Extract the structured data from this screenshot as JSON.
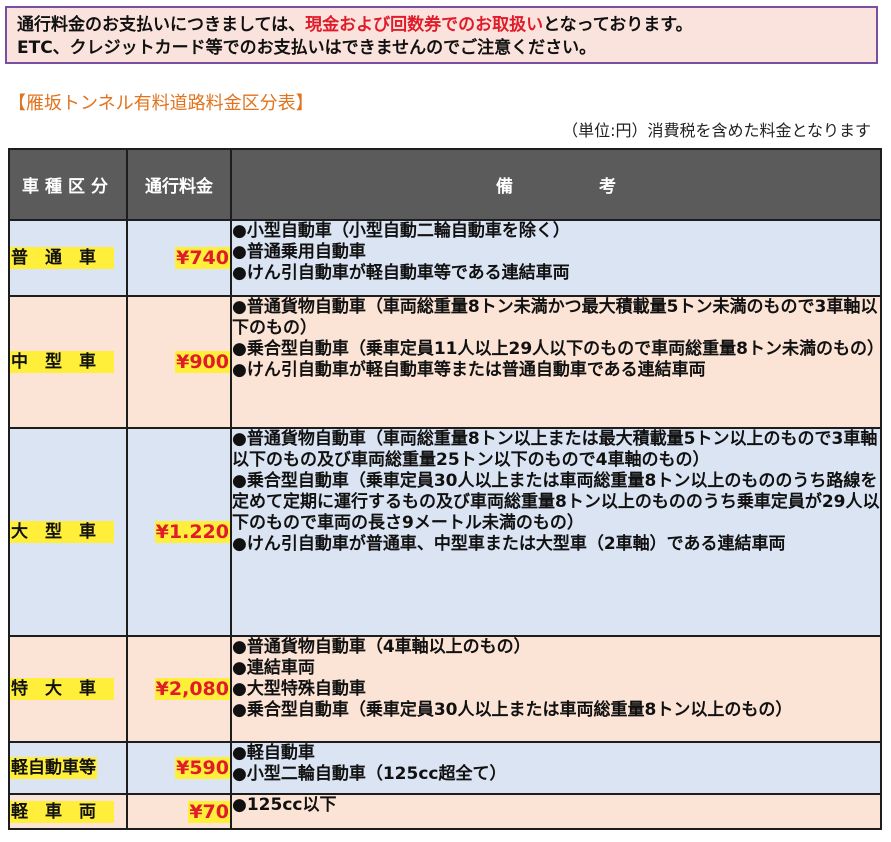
{
  "notice": {
    "line1_before": "通行料金のお支払いにつきましては、",
    "line1_highlight": "現金および回数券でのお取扱い",
    "line1_after": "となっております。",
    "line2": "ETC、クレジットカード等でのお支払いはできませんのでご注意ください。"
  },
  "section_title": "【雁坂トンネル有料道路料金区分表】",
  "unit_note": "（単位:円）消費税を含めた料金となります",
  "table": {
    "headers": {
      "type": "車種区分",
      "fee": "通行料金",
      "remarks": "備 考"
    },
    "rows": [
      {
        "type": "普通車",
        "fee": "¥740",
        "remarks": [
          "●小型自動車（小型自動二輪自動車を除く）",
          "●普通乗用自動車",
          "●けん引自動車が軽自動車等である連結車両"
        ]
      },
      {
        "type": "中型車",
        "fee": "¥900",
        "remarks": [
          "●普通貨物自動車（車両総重量8トン未満かつ最大積載量5トン未満のもので3車軸以下のもの）",
          "●乗合型自動車（乗車定員11人以上29人以下のもので車両総重量8トン未満のもの）",
          "●けん引自動車が軽自動車等または普通自動車である連結車両"
        ]
      },
      {
        "type": "大型車",
        "fee": "¥1.220",
        "remarks": [
          "●普通貨物自動車（車両総重量8トン以上または最大積載量5トン以上のもので3車軸以下のもの及び車両総重量25トン以下のもので4車軸のもの）",
          "●乗合型自動車（乗車定員30人以上または車両総重量8トン以上のもののうち路線を定めて定期に運行するもの及び車両総重量8トン以上のもののうち乗車定員が29人以下のもので車両の長さ9メートル未満のもの）",
          "●けん引自動車が普通車、中型車または大型車（2車軸）である連結車両"
        ]
      },
      {
        "type": "特大車",
        "fee": "¥2,080",
        "remarks": [
          "●普通貨物自動車（4車軸以上のもの）",
          "●連結車両",
          "●大型特殊自動車",
          "●乗合型自動車（乗車定員30人以上または車両総重量8トン以上のもの）"
        ]
      },
      {
        "type": "軽自動車等",
        "fee": "¥590",
        "remarks": [
          "●軽自動車",
          "●小型二輪自動車（125cc超全て）"
        ]
      },
      {
        "type": "軽車両",
        "fee": "¥70",
        "remarks": [
          "●125cc以下"
        ]
      }
    ]
  },
  "colors": {
    "notice_border": "#7a4ea0",
    "notice_bg": "#fbe3dd",
    "highlight_text": "#e01c2a",
    "section_title": "#e2731e",
    "header_bg": "#5b5b5b",
    "row_blue": "#dbe4f3",
    "row_pink": "#fbe3d6",
    "label_highlight": "#ffef3a"
  }
}
